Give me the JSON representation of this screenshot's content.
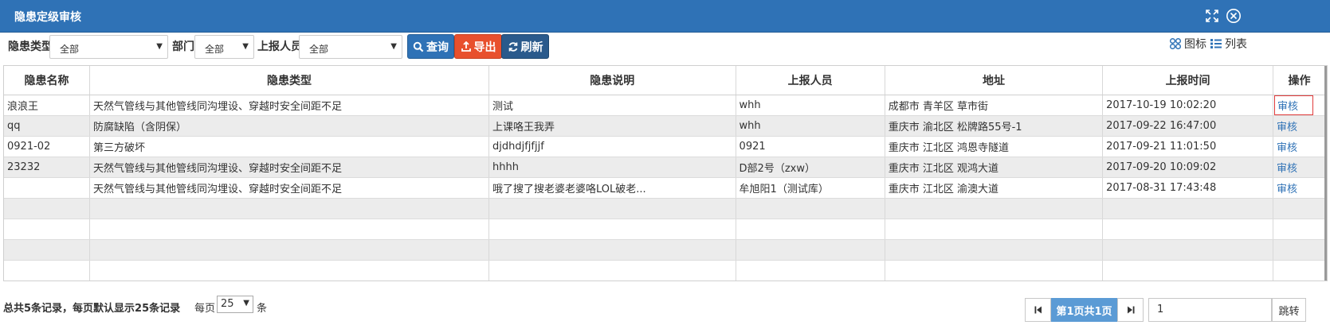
{
  "window": {
    "title": "隐患定级审核"
  },
  "toolbar": {
    "type_label": "隐患类型",
    "type_value": "全部",
    "dept_label": "部门",
    "dept_value": "全部",
    "reporter_label": "上报人员",
    "reporter_value": "全部",
    "query_label": "查询",
    "export_label": "导出",
    "refresh_label": "刷新",
    "view_icon_label": "图标",
    "view_list_label": "列表"
  },
  "table": {
    "headers": [
      "隐患名称",
      "隐患类型",
      "隐患说明",
      "上报人员",
      "地址",
      "上报时间",
      "操作"
    ],
    "rows": [
      [
        "浪浪王",
        "天然气管线与其他管线同沟埋设、穿越时安全间距不足",
        "测试",
        "whh",
        "成都市 青羊区 草市街",
        "2017-10-19 10:02:20",
        "审核"
      ],
      [
        "qq",
        "防腐缺陷（含阴保）",
        "上课咯王我弄",
        "whh",
        "重庆市 渝北区 松牌路55号-1",
        "2017-09-22 16:47:00",
        "审核"
      ],
      [
        "0921-02",
        "第三方破坏",
        "djdhdjfjfjjf",
        "0921",
        "重庆市 江北区 鸿恩寺隧道",
        "2017-09-21 11:01:50",
        "审核"
      ],
      [
        "23232",
        "天然气管线与其他管线同沟埋设、穿越时安全间距不足",
        "hhhh",
        "D部2号（zxw）",
        "重庆市 江北区 观鸿大道",
        "2017-09-20 10:09:02",
        "审核"
      ],
      [
        "",
        "天然气管线与其他管线同沟埋设、穿越时安全间距不足",
        "哦了搜了搜老婆老婆咯LOL破老...",
        "牟旭阳1（测试库）",
        "重庆市 江北区 渝澳大道",
        "2017-08-31 17:43:48",
        "审核"
      ]
    ]
  },
  "footer": {
    "summary": "总共5条记录，每页默认显示25条记录",
    "per_page_label": "每页",
    "per_page_value": "25",
    "unit_label": "条",
    "page_info": "第1页共1页",
    "page_input": "1",
    "jump_label": "跳转"
  },
  "colors": {
    "title_bar": "#2f72b6",
    "export": "#e8502d",
    "refresh": "#2a5a8c",
    "page_active": "#5b9bd5",
    "link": "#2f72b6"
  }
}
